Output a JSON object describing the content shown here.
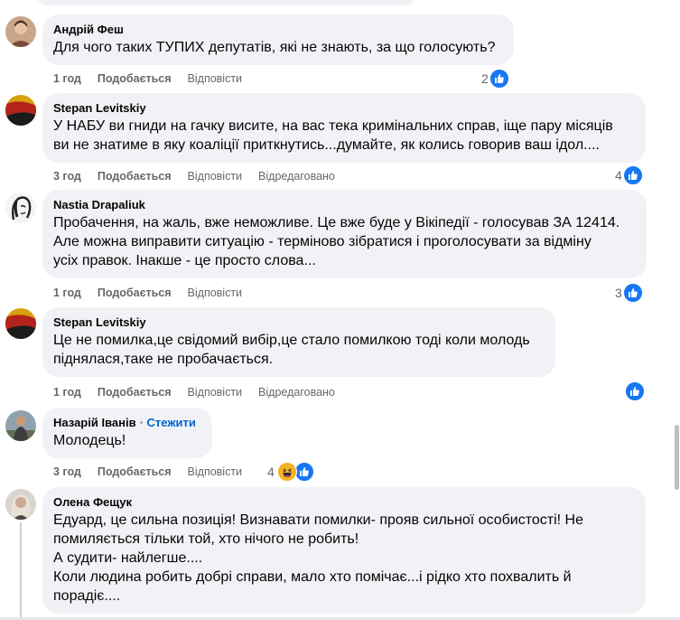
{
  "comments": [
    {
      "author": "Андрій Феш",
      "text": "Для чого таких ТУПИХ депутатів, які не знають, за що голосують?",
      "time": "1 год",
      "like_label": "Подобається",
      "reply_label": "Відповісти",
      "edited_label": "",
      "reaction_count": "2",
      "avatar_icon": "person-photo"
    },
    {
      "author": "Stepan Levitskiy",
      "text": "У НАБУ ви гниди на гачку висите, на вас тека кримінальних справ, іще пару місяців\nви не знатиме в яку коаліції приткнутись...думайте, як колись говорив ваш ідол....",
      "time": "3 год",
      "like_label": "Подобається",
      "reply_label": "Відповісти",
      "edited_label": "Відредаговано",
      "reaction_count": "4",
      "avatar_icon": "flag-red-black"
    },
    {
      "author": "Nastia Drapaliuk",
      "text": "Пробачення, на жаль, вже неможливе. Це вже буде у Вікіпедії - голосував ЗА 12414.\nАле можна виправити ситуацію - терміново зібратися і проголосувати за відміну\nусіх правок. Інакше - це просто слова...",
      "time": "1 год",
      "like_label": "Подобається",
      "reply_label": "Відповісти",
      "edited_label": "",
      "reaction_count": "3",
      "avatar_icon": "face-sketch"
    },
    {
      "author": "Stepan Levitskiy",
      "text": "Це не помилка,це свідомий вибір,це стало помилкою тоді коли молодь\nпіднялася,таке не пробачається.",
      "time": "1 год",
      "like_label": "Подобається",
      "reply_label": "Відповісти",
      "edited_label": "Відредаговано",
      "reaction_count": "",
      "avatar_icon": "flag-red-black"
    },
    {
      "author": "Назарій Іванів",
      "follow_label": "Стежити",
      "text": "Молодець!",
      "time": "3 год",
      "like_label": "Подобається",
      "reply_label": "Відповісти",
      "edited_label": "",
      "reaction_count": "4",
      "avatar_icon": "person-photo"
    },
    {
      "author": "Олена Фещук",
      "text": "Едуард, це сильна позиція! Визнавати помилки- прояв сильної особистості! Не\nпомиляється тільки той, хто нічого не робить!\nА судити- найлегше....\nКоли людина робить добрі справи, мало хто помічає...і рідко хто похвалить й\nпорадіє....",
      "avatar_icon": "person-photo"
    }
  ],
  "colors": {
    "bubble": "#f0f2f5",
    "like_blue": "#1877f2",
    "link_blue": "#0064d1",
    "meta_gray": "#65676b",
    "haha_yellow": "#f7b125"
  }
}
